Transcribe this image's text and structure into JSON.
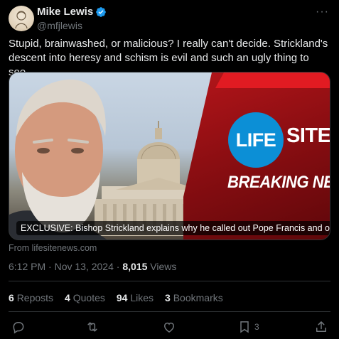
{
  "author": {
    "name": "Mike Lewis",
    "handle": "@mfjlewis"
  },
  "tweet": {
    "text": "Stupid, brainwashed, or malicious? I really can't decide. Strickland's descent into heresy and schism is evil and such an ugly thing to see."
  },
  "card": {
    "logo_left": "LIFE",
    "logo_right": "SITE",
    "banner": "BREAKING NEWS",
    "caption": "EXCLUSIVE: Bishop Strickland explains why he called out Pope Francis and other bish…",
    "source": "From lifesitenews.com"
  },
  "meta": {
    "time": "6:12 PM",
    "separator1": " · ",
    "date": "Nov 13, 2024",
    "separator2": " · ",
    "views_count": "8,015",
    "views_label": " Views"
  },
  "stats": [
    {
      "num": "6",
      "label": "Reposts"
    },
    {
      "num": "4",
      "label": "Quotes"
    },
    {
      "num": "94",
      "label": "Likes"
    },
    {
      "num": "3",
      "label": "Bookmarks"
    }
  ],
  "actions": {
    "bookmark_count": "3"
  },
  "colors": {
    "background": "#000000",
    "text": "#e7e9ea",
    "muted": "#71767b",
    "verified": "#1d9bf0",
    "lifesite_red": "#b4151a",
    "lifesite_blue": "#0c8fd6"
  },
  "icons": [
    "verified-icon",
    "more-icon",
    "reply-icon",
    "retweet-icon",
    "like-icon",
    "bookmark-icon",
    "share-icon"
  ]
}
